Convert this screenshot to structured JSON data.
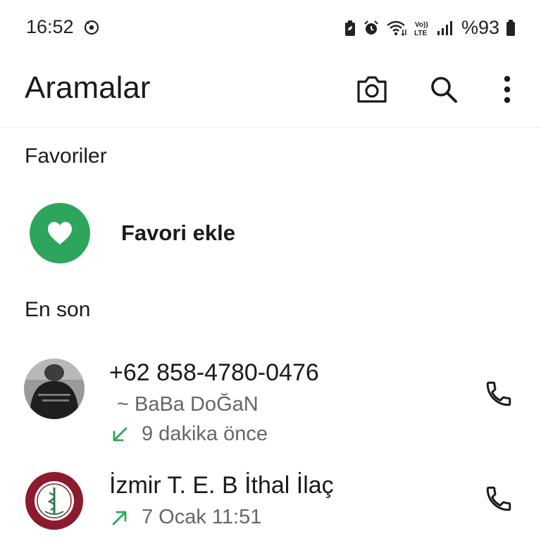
{
  "status_bar": {
    "time": "16:52",
    "battery": "%93",
    "icons": [
      "sync-icon",
      "battery-saver-icon",
      "alarm-icon",
      "wifi-icon",
      "volte-icon",
      "signal-icon",
      "battery-icon"
    ]
  },
  "app_bar": {
    "title": "Aramalar",
    "actions": [
      "camera-icon",
      "search-icon",
      "more-vert-icon"
    ]
  },
  "favorites": {
    "header": "Favoriler",
    "add_label": "Favori ekle"
  },
  "recents": {
    "header": "En son",
    "calls": [
      {
        "name": "+62 858-4780-0476",
        "subtitle": "~ BaBa DoĞaN",
        "direction": "incoming",
        "time": "9 dakika önce"
      },
      {
        "name": "İzmir T. E. B İthal İlaç",
        "direction": "outgoing",
        "time": "7 Ocak 11:51"
      }
    ]
  },
  "colors": {
    "accent_green": "#2ea55c",
    "text_primary": "#1a1a1a",
    "text_secondary": "#666666"
  }
}
